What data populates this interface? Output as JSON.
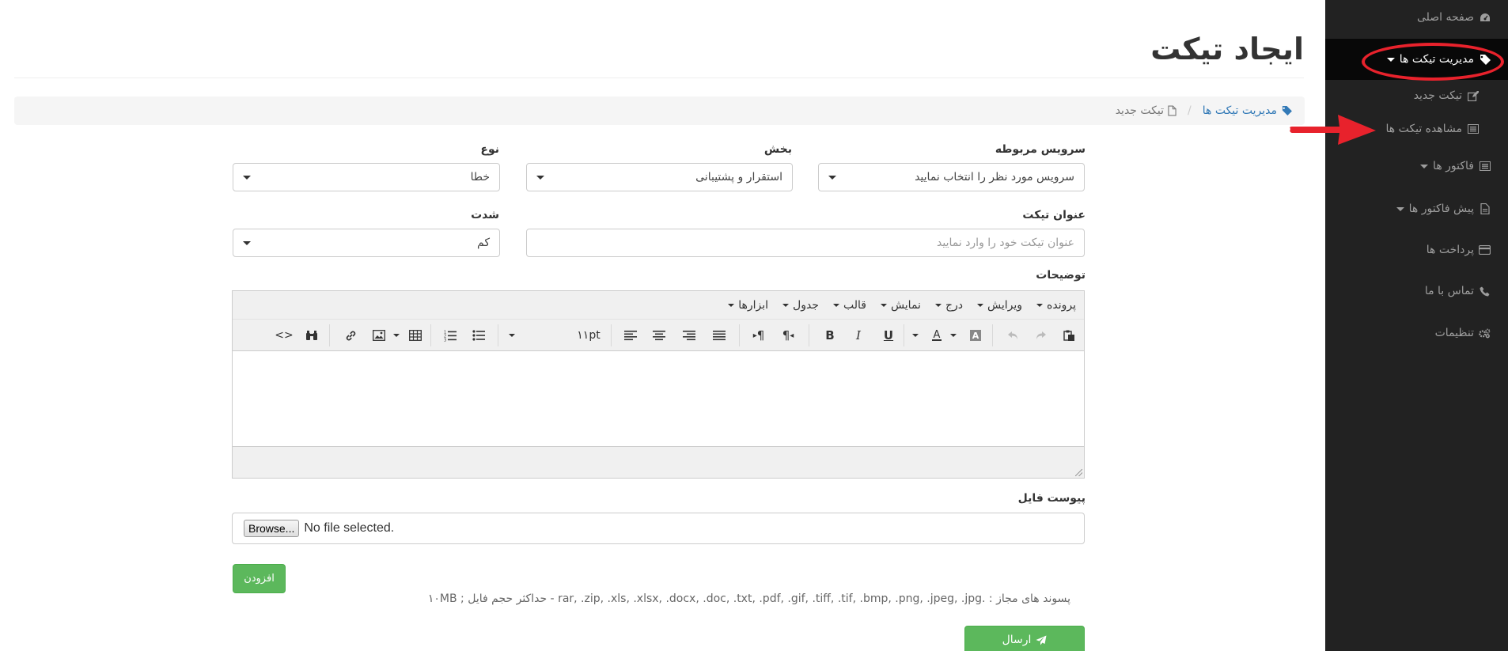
{
  "sidebar": {
    "items": [
      {
        "label": "صفحه اصلی",
        "icon": "dashboard-icon"
      },
      {
        "label": "مدیریت تیکت ها",
        "icon": "ticket-icon",
        "active": true
      },
      {
        "label": "تیکت جدید",
        "icon": "edit-icon"
      },
      {
        "label": "مشاهده تیکت ها",
        "icon": "list-icon"
      },
      {
        "label": "فاکتور ها",
        "icon": "invoice-icon"
      },
      {
        "label": "پیش فاکتور ها",
        "icon": "document-icon"
      },
      {
        "label": "پرداخت ها",
        "icon": "credit-card-icon"
      },
      {
        "label": "تماس با ما",
        "icon": "phone-icon"
      },
      {
        "label": "تنظیمات",
        "icon": "gears-icon"
      }
    ]
  },
  "page": {
    "title": "ایجاد تیکت"
  },
  "breadcrumb": {
    "parent": "مدیریت تیکت ها",
    "current": "تیکت جدید"
  },
  "form": {
    "service_label": "سرویس مربوطه",
    "service_value": "سرویس مورد نظر را انتخاب نمایید",
    "section_label": "بخش",
    "section_value": "استقرار و پشتیبانی",
    "type_label": "نوع",
    "type_value": "خطا",
    "title_label": "عنوان تیکت",
    "title_placeholder": "عنوان تیکت خود را وارد نمایید",
    "severity_label": "شدت",
    "severity_value": "کم",
    "description_label": "توضیحات",
    "attachment_label": "پیوست فایل",
    "browse_label": "Browse...",
    "no_file_label": "No file selected.",
    "add_button": "افزودن",
    "allowed_text": "پسوند های مجاز : .rar, .zip, .xls, .xlsx, .docx, .doc, .txt, .pdf, .gif, .tiff, .tif, .bmp, .png, .jpeg, .jpg - حداکثر حجم فایل ; ۱۰MB",
    "submit_button": "ارسال"
  },
  "editor": {
    "menus": [
      "پرونده",
      "ویرایش",
      "درج",
      "نمایش",
      "قالب",
      "جدول",
      "ابزارها"
    ],
    "font_size": "۱۱pt"
  },
  "colors": {
    "sidebar_bg": "#222222",
    "sidebar_active_bg": "#080808",
    "link": "#337ab7",
    "success": "#5cb85c",
    "annotation_red": "#e8222c"
  }
}
